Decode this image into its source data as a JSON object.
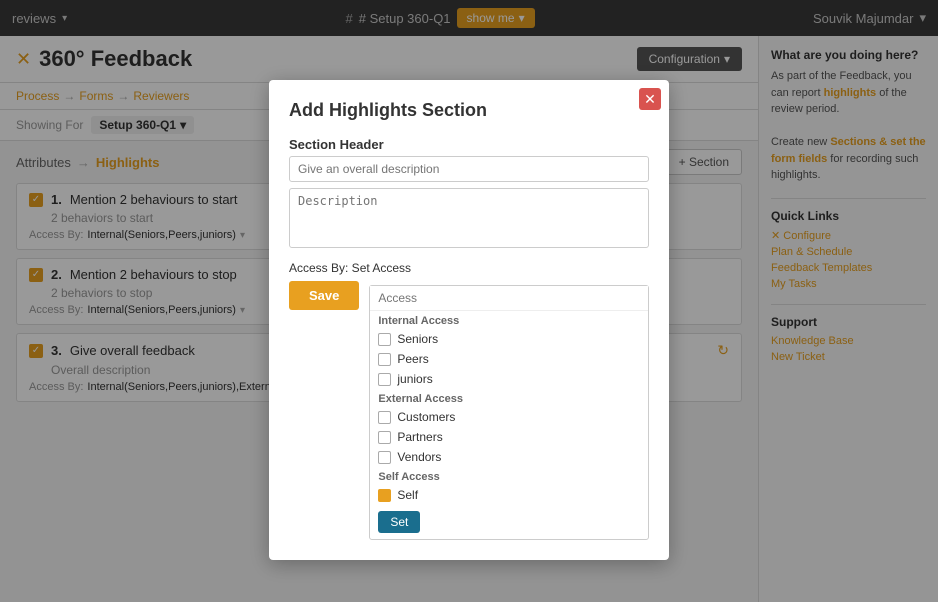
{
  "topNav": {
    "reviews_label": "reviews",
    "setup_label": "# Setup 360-Q1",
    "show_me_label": "show me",
    "user_label": "Souvik Majumdar"
  },
  "page": {
    "icon": "✕",
    "title": "360° Feedback",
    "config_btn": "Configuration",
    "breadcrumb": [
      "Process",
      "Forms",
      "Reviewers"
    ],
    "showing_for_label": "Showing For",
    "showing_for_value": "Setup 360-Q1",
    "attributes_label": "Attributes",
    "highlights_label": "Highlights",
    "add_section_btn": "+ Section"
  },
  "items": [
    {
      "number": "1.",
      "title": "Mention 2 behaviours to start",
      "desc": "2 behaviors to start",
      "access_label": "Access By:",
      "access_value": "Internal(Seniors,Peers,juniors)"
    },
    {
      "number": "2.",
      "title": "Mention 2 behaviours to stop",
      "desc": "2 behaviors to stop",
      "access_label": "Access By:",
      "access_value": "Internal(Seniors,Peers,juniors)"
    },
    {
      "number": "3.",
      "title": "Give overall feedback",
      "desc": "Overall description",
      "access_label": "Access By:",
      "access_value": "Internal(Seniors,Peers,juniors),External(Customers,Par..."
    }
  ],
  "sidebar": {
    "question": "What are you doing here?",
    "description_p1": "As part of the Feedback, you can report ",
    "highlights_keyword": "highlights",
    "description_p2": " of the review period.",
    "description_p3": "Create new ",
    "sections_keyword": "Sections & set the form",
    "fields_keyword": "fields",
    "description_p4": " for recording such highlights.",
    "quicklinks_title": "Quick Links",
    "links": [
      {
        "icon": "✕",
        "label": "Configure"
      },
      {
        "label": "Plan & Schedule"
      },
      {
        "label": "Feedback Templates"
      },
      {
        "label": "My Tasks"
      }
    ],
    "support_title": "Support",
    "support_links": [
      {
        "label": "Knowledge Base"
      },
      {
        "label": "New Ticket"
      }
    ]
  },
  "modal": {
    "title": "Add Highlights Section",
    "section_header_label": "Section Header",
    "description_placeholder": "Give an overall description",
    "description_field_placeholder": "Description",
    "access_label": "Access By: Set Access",
    "save_btn": "Save",
    "access_search_placeholder": "Access",
    "access_groups": [
      {
        "group": "Internal Access",
        "items": [
          {
            "label": "Seniors",
            "checked": false
          },
          {
            "label": "Peers",
            "checked": false
          },
          {
            "label": "juniors",
            "checked": false
          }
        ]
      },
      {
        "group": "External Access",
        "items": [
          {
            "label": "Customers",
            "checked": false
          },
          {
            "label": "Partners",
            "checked": false
          },
          {
            "label": "Vendors",
            "checked": false
          }
        ]
      },
      {
        "group": "Self Access",
        "items": [
          {
            "label": "Self",
            "checked": true
          }
        ]
      }
    ],
    "set_btn": "Set"
  }
}
